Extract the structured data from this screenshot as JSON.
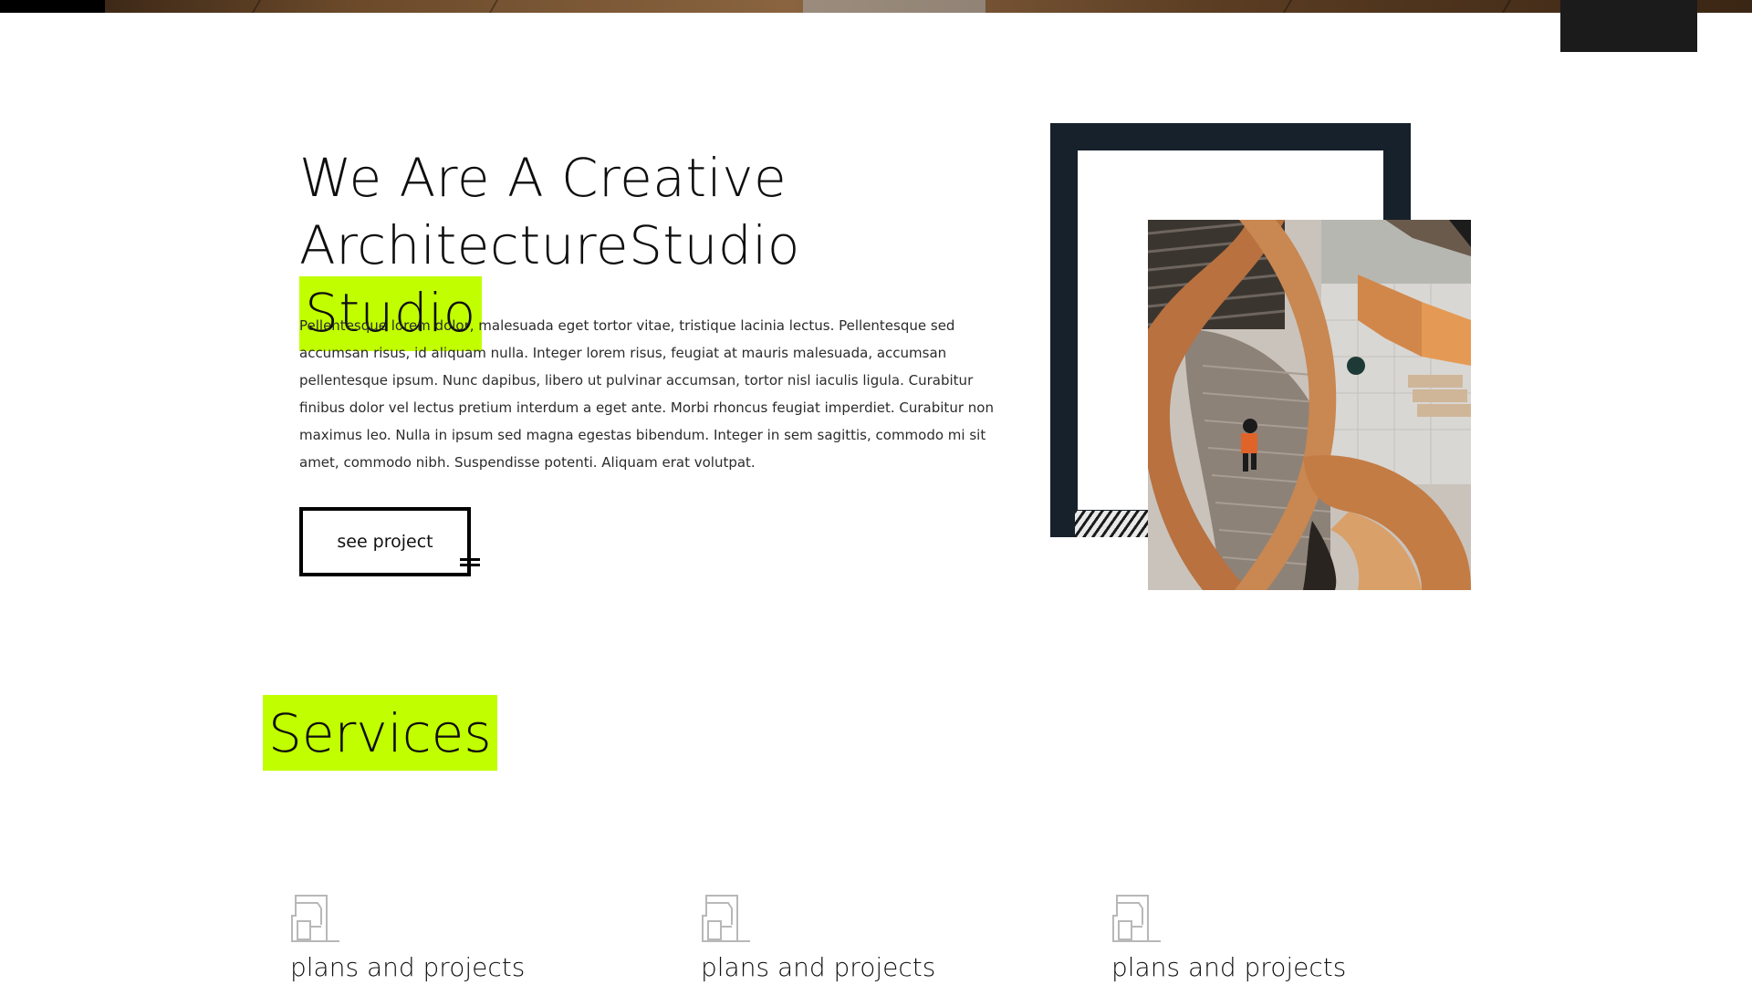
{
  "about": {
    "heading_line1": "We Are A Creative",
    "heading_line2": "ArchitectureStudio",
    "heading_highlight": "Studio",
    "paragraph": "Pellentesque lorem dolor, malesuada eget tortor vitae, tristique lacinia lectus. Pellentesque sed accumsan risus, id aliquam nulla. Integer lorem risus, feugiat at mauris malesuada, accumsan pellentesque ipsum. Nunc dapibus, libero ut pulvinar accumsan, tortor nisl iaculis ligula. Curabitur finibus dolor vel lectus pretium interdum a eget ante. Morbi rhoncus feugiat imperdiet. Curabitur non maximus leo. Nulla in ipsum sed magna egestas bibendum. Integer in sem sagittis, commodo mi sit amet, commodo nibh. Suspendisse potenti. Aliquam erat volutpat.",
    "button_label": "see project"
  },
  "services": {
    "title": "Services",
    "items": [
      {
        "icon": "building-plan-icon",
        "title": "plans and projects"
      },
      {
        "icon": "building-plan-icon",
        "title": "plans and projects"
      },
      {
        "icon": "building-plan-icon",
        "title": "plans and projects"
      }
    ]
  },
  "colors": {
    "accent": "#c1ff00",
    "frame": "#16212b",
    "text": "#0e0e0e",
    "menu_block": "#1b1b1b"
  }
}
